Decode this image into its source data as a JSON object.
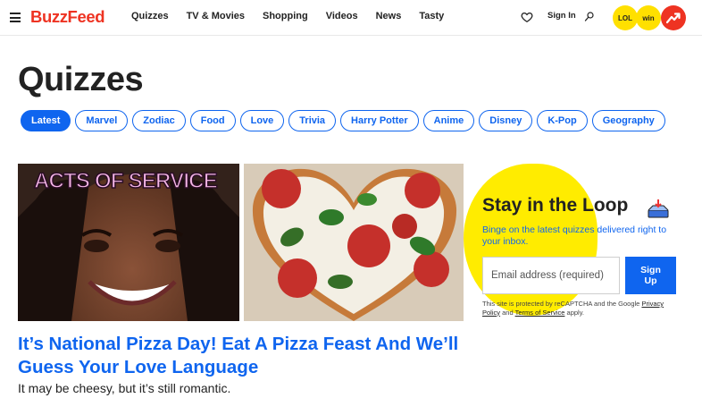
{
  "header": {
    "logo": "BuzzFeed",
    "nav": [
      "Quizzes",
      "TV & Movies",
      "Shopping",
      "Videos",
      "News",
      "Tasty"
    ],
    "sign_in": "Sign In",
    "badges": {
      "lol": "LOL",
      "win": "win"
    }
  },
  "page": {
    "title": "Quizzes",
    "tags": [
      "Latest",
      "Marvel",
      "Zodiac",
      "Food",
      "Love",
      "Trivia",
      "Harry Potter",
      "Anime",
      "Disney",
      "K-Pop",
      "Geography"
    ],
    "active_tag": "Latest"
  },
  "article": {
    "image_caption": "ACTS OF SERVICE",
    "headline": "It’s National Pizza Day! Eat A Pizza Feast And We’ll Guess Your Love Language",
    "subtext": "It may be cheesy, but it’s still romantic."
  },
  "newsletter": {
    "title": "Stay in the Loop",
    "description": "Binge on the latest quizzes delivered right to your inbox.",
    "email_placeholder": "Email address (required)",
    "signup_line1": "Sign",
    "signup_line2": "Up",
    "recaptcha_prefix": "This site is protected by reCAPTCHA and the Google",
    "privacy_link": "Privacy Policy",
    "and_text": "and",
    "terms_link": "Terms of Service",
    "apply_text": "apply."
  },
  "colors": {
    "brand_red": "#ee3322",
    "link_blue": "#0f65ef",
    "accent_yellow": "#ffec00"
  }
}
